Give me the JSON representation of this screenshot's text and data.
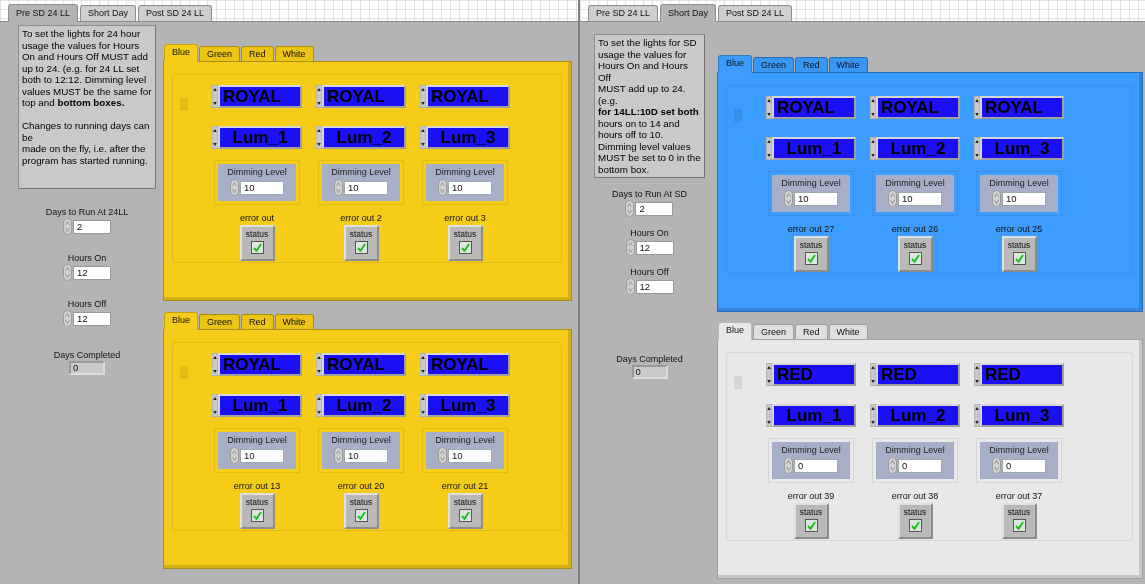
{
  "views": [
    {
      "tabs": [
        {
          "label": "Pre SD 24 LL",
          "selected": true
        },
        {
          "label": "Short Day",
          "selected": false
        },
        {
          "label": "Post SD 24 LL",
          "selected": false
        }
      ],
      "instructions": "To set the lights for 24 hour usage the values for Hours On and Hours Off MUST add up to 24. (e.g. for 24 LL set both to 12:12. Dimming level values MUST be the same for top and **bottom boxes.**\n\nChanges to running days can be\nmade on the fly, i.e. after the program has started running.",
      "fields": [
        {
          "kind": "control",
          "label": "Days to Run At 24LL",
          "value": "2"
        },
        {
          "kind": "control",
          "label": "Hours On",
          "value": "12"
        },
        {
          "kind": "control",
          "label": "Hours Off",
          "value": "12"
        },
        {
          "kind": "indicator",
          "label": "Days Completed",
          "value": "0"
        }
      ],
      "tab_controls": [
        {
          "color": "#f5cc17",
          "tabs": [
            {
              "label": "Blue",
              "selected": true
            },
            {
              "label": "Green",
              "selected": false
            },
            {
              "label": "Red",
              "selected": false
            },
            {
              "label": "White",
              "selected": false
            }
          ],
          "channels": [
            {
              "preset": "ROYAL",
              "lum": "Lum_1",
              "dimming_label": "Dimming Level",
              "dimming": "10",
              "error_label": "error out",
              "status_label": "status",
              "status": true
            },
            {
              "preset": "ROYAL",
              "lum": "Lum_2",
              "dimming_label": "Dimming Level",
              "dimming": "10",
              "error_label": "error out 2",
              "status_label": "status",
              "status": true
            },
            {
              "preset": "ROYAL",
              "lum": "Lum_3",
              "dimming_label": "Dimming Level",
              "dimming": "10",
              "error_label": "error out 3",
              "status_label": "status",
              "status": true
            }
          ]
        },
        {
          "color": "#f5cc17",
          "tabs": [
            {
              "label": "Blue",
              "selected": true
            },
            {
              "label": "Green",
              "selected": false
            },
            {
              "label": "Red",
              "selected": false
            },
            {
              "label": "White",
              "selected": false
            }
          ],
          "channels": [
            {
              "preset": "ROYAL",
              "lum": "Lum_1",
              "dimming_label": "Dimming Level",
              "dimming": "10",
              "error_label": "error out 13",
              "status_label": "status",
              "status": true
            },
            {
              "preset": "ROYAL",
              "lum": "Lum_2",
              "dimming_label": "Dimming Level",
              "dimming": "10",
              "error_label": "error out 20",
              "status_label": "status",
              "status": true
            },
            {
              "preset": "ROYAL",
              "lum": "Lum_3",
              "dimming_label": "Dimming Level",
              "dimming": "10",
              "error_label": "error out 21",
              "status_label": "status",
              "status": true
            }
          ]
        }
      ]
    },
    {
      "tabs": [
        {
          "label": "Pre SD 24 LL",
          "selected": false
        },
        {
          "label": "Short Day",
          "selected": true
        },
        {
          "label": "Post SD 24 LL",
          "selected": false
        }
      ],
      "instructions": "To set the lights for SD usage the values for Hours On and Hours Off\nMUST add up to 24.\n(e.g.\n**for 14LL:10D set both** hours on to 14 and hours off to 10.\nDimming level values MUST be set to 0 in the bottom box.",
      "fields": [
        {
          "kind": "control",
          "label": "Days to Run At SD",
          "value": "2"
        },
        {
          "kind": "control",
          "label": "Hours On",
          "value": "12"
        },
        {
          "kind": "control",
          "label": "Hours Off",
          "value": "12"
        },
        {
          "kind": "indicator",
          "label": "Days Completed",
          "value": "0"
        }
      ],
      "tab_controls": [
        {
          "color": "#3c9cff",
          "tabs": [
            {
              "label": "Blue",
              "selected": true
            },
            {
              "label": "Green",
              "selected": false
            },
            {
              "label": "Red",
              "selected": false
            },
            {
              "label": "White",
              "selected": false
            }
          ],
          "channels": [
            {
              "preset": "ROYAL",
              "lum": "Lum_1",
              "dimming_label": "Dimming Level",
              "dimming": "10",
              "error_label": "error out 27",
              "status_label": "status",
              "status": true
            },
            {
              "preset": "ROYAL",
              "lum": "Lum_2",
              "dimming_label": "Dimming Level",
              "dimming": "10",
              "error_label": "error out 26",
              "status_label": "status",
              "status": true
            },
            {
              "preset": "ROYAL",
              "lum": "Lum_3",
              "dimming_label": "Dimming Level",
              "dimming": "10",
              "error_label": "error out 25",
              "status_label": "status",
              "status": true
            }
          ]
        },
        {
          "color": "#e8e8e8",
          "tabs": [
            {
              "label": "Blue",
              "selected": true
            },
            {
              "label": "Green",
              "selected": false
            },
            {
              "label": "Red",
              "selected": false
            },
            {
              "label": "White",
              "selected": false
            }
          ],
          "channels": [
            {
              "preset": "RED",
              "lum": "Lum_1",
              "dimming_label": "Dimming Level",
              "dimming": "0",
              "error_label": "error out 39",
              "status_label": "status",
              "status": true
            },
            {
              "preset": "RED",
              "lum": "Lum_2",
              "dimming_label": "Dimming Level",
              "dimming": "0",
              "error_label": "error out 38",
              "status_label": "status",
              "status": true
            },
            {
              "preset": "RED",
              "lum": "Lum_3",
              "dimming_label": "Dimming Level",
              "dimming": "0",
              "error_label": "error out 37",
              "status_label": "status",
              "status": true
            }
          ]
        }
      ]
    }
  ]
}
